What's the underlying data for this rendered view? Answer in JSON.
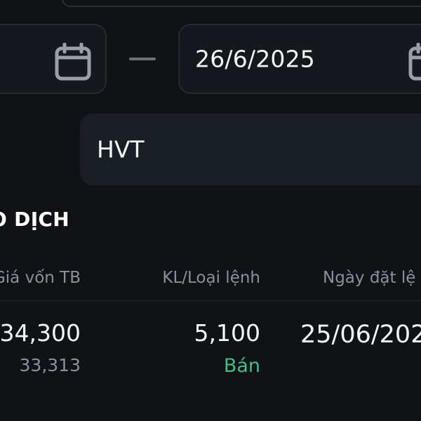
{
  "filters": {
    "date_from": "",
    "date_to": "26/6/2025",
    "range_separator": "—",
    "symbol": "HVT"
  },
  "section": {
    "title": "O DỊCH"
  },
  "table": {
    "headers": {
      "avg_price": "Giá vốn TB",
      "qty_type": "KL/Loại lệnh",
      "order_date": "Ngày đặt lệ"
    },
    "rows": [
      {
        "price": "34,300",
        "avg_price": "33,313",
        "qty": "5,100",
        "order_type": "Bán",
        "order_date": "25/06/202"
      }
    ]
  },
  "colors": {
    "background": "#111216",
    "field": "#15181d",
    "sell_green": "#3fbf85",
    "muted_text": "#8b909a"
  },
  "icons": {
    "calendar": "calendar-icon"
  }
}
